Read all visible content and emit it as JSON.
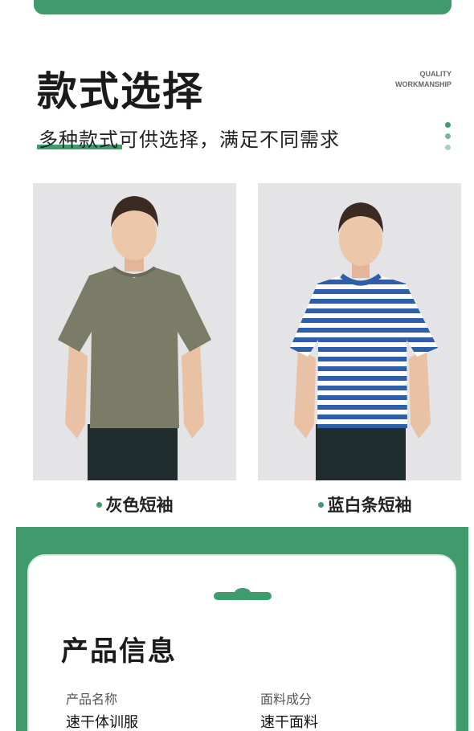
{
  "header": {
    "title": "款式选择",
    "tag_line_1": "QUALITY",
    "tag_line_2": "WORKMANSHIP",
    "subtitle": "多种款式可供选择，满足不同需求"
  },
  "styles": [
    {
      "label": "灰色短袖",
      "shirt_color": "#7a7c68"
    },
    {
      "label": "蓝白条短袖",
      "stripe_color": "#2f5ea8"
    }
  ],
  "product_info": {
    "title": "产品信息",
    "fields": [
      {
        "label": "产品名称",
        "value": "速干体训服"
      },
      {
        "label": "面料成分",
        "value": "速干面料"
      }
    ]
  },
  "colors": {
    "accent": "#3f9a6c",
    "photo_bg": "#e4e4e6"
  }
}
